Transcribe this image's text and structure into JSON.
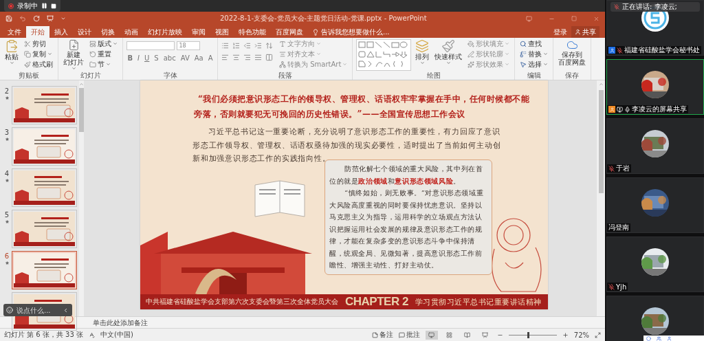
{
  "recorder": {
    "label": "录制中"
  },
  "title": "2022-8-1-支委会-党员大会-主题党日活动-党课.pptx - PowerPoint",
  "tabs": [
    {
      "label": "文件",
      "selected": false
    },
    {
      "label": "开始",
      "selected": true
    },
    {
      "label": "插入",
      "selected": false
    },
    {
      "label": "设计",
      "selected": false
    },
    {
      "label": "切换",
      "selected": false
    },
    {
      "label": "动画",
      "selected": false
    },
    {
      "label": "幻灯片放映",
      "selected": false
    },
    {
      "label": "审阅",
      "selected": false
    },
    {
      "label": "视图",
      "selected": false
    },
    {
      "label": "特色功能",
      "selected": false
    },
    {
      "label": "百度网盘",
      "selected": false
    }
  ],
  "tell_me": "告诉我您想要做什么...",
  "sign_in": "登录",
  "share": "共享",
  "ribbon": [
    {
      "kind": "clipboard",
      "label": "剪贴板",
      "big": [
        {
          "lines": [
            "粘贴"
          ],
          "dropdown": true
        }
      ],
      "small": [
        {
          "label": "剪切",
          "dropdown": false
        },
        {
          "label": "复制",
          "dropdown": true
        },
        {
          "label": "格式刷",
          "dropdown": false
        }
      ]
    },
    {
      "kind": "slides",
      "label": "幻灯片",
      "big": [
        {
          "lines": [
            "新建",
            "幻灯片"
          ],
          "dropdown": true
        }
      ],
      "small": [
        {
          "label": "版式",
          "dropdown": true
        },
        {
          "label": "重置",
          "dropdown": false
        },
        {
          "label": "节",
          "dropdown": true
        }
      ]
    },
    {
      "kind": "font",
      "label": "字体",
      "font_size": "18",
      "buttons": [
        "B",
        "I",
        "U",
        "S",
        "abc",
        "AV",
        "Aa",
        "A"
      ]
    },
    {
      "kind": "paragraph",
      "label": "段落",
      "small": [
        {
          "label": "文字方向",
          "dropdown": true
        },
        {
          "label": "对齐文本",
          "dropdown": true
        },
        {
          "label": "转换为 SmartArt",
          "dropdown": true
        }
      ]
    },
    {
      "kind": "drawing",
      "label": "绘图",
      "big": [
        {
          "lines": [
            "排列"
          ],
          "dropdown": true
        },
        {
          "lines": [
            "快速样式"
          ],
          "dropdown": true
        }
      ],
      "small": [
        {
          "label": "形状填充",
          "dropdown": true
        },
        {
          "label": "形状轮廓",
          "dropdown": true
        },
        {
          "label": "形状效果",
          "dropdown": true
        }
      ]
    },
    {
      "kind": "editing",
      "label": "编辑",
      "small": [
        {
          "label": "查找",
          "dropdown": false
        },
        {
          "label": "替换",
          "dropdown": true
        },
        {
          "label": "选择",
          "dropdown": true
        }
      ]
    },
    {
      "kind": "save",
      "label": "保存",
      "big": [
        {
          "lines": [
            "保存到",
            "百度网盘"
          ],
          "dropdown": false
        }
      ]
    }
  ],
  "thumbnails": [
    {
      "number": "2",
      "selected": false
    },
    {
      "number": "3",
      "selected": false
    },
    {
      "number": "4",
      "selected": false
    },
    {
      "number": "5",
      "selected": false
    },
    {
      "number": "6",
      "selected": true
    },
    {
      "selected": false
    }
  ],
  "chat": {
    "placeholder": "说点什么..."
  },
  "slide": {
    "quote": "“我们必须把意识形态工作的领导权、管理权、话语权牢牢掌握在手中，任何时候都不能旁落，否则就要犯无可挽回的历史性错误。”——全国宣传思想工作会议",
    "paragraph": "习近平总书记这一重要论断，充分说明了意识形态工作的重要性，有力回应了意识形态工作领导权、管理权、话语权亟待加强的现实必要性，适时提出了当前如何主动创新和加强意识形态工作的实践指向性。",
    "box": [
      "防范化解七个领域的重大风险，其中列在首位的就是**政治领域**和**意识形态领域风险**。",
      "“慎终如始，则无败事。”对意识形态领域重大风险高度重视的同时要保持忧患意识。坚持以马克思主义为指导，运用科学的立场观点方法认识把握运用社会发展的规律及意识形态工作的规律，才能在复杂多变的意识形态斗争中保持清醒，统观全局、见微知著，提高意识形态工作前瞻性、增强主动性、打好主动仗。"
    ],
    "footer_org": "中共福建省硅酸盐学会支部第六次支委会暨第三次全体党员大会",
    "chapter": "CHAPTER 2",
    "chapter_title": "学习贯彻习近平总书记重要讲话精神"
  },
  "notes": {
    "placeholder": "单击此处添加备注"
  },
  "status": {
    "slide_info": "幻灯片 第 6 张，共 33 张",
    "language": "中文(中国)",
    "notes": "备注",
    "comments": "批注",
    "views": [
      {
        "selected": true
      },
      {
        "selected": false
      },
      {
        "selected": false
      },
      {
        "selected": false
      }
    ],
    "zoom": {
      "level": 0.4,
      "reading": "72%"
    }
  },
  "meeting": {
    "speaking": "正在讲话: 李凌云;",
    "participants": [
      {
        "name": "福建省硅酸盐学会秘书处",
        "color": "#1f6fe5",
        "muted": true,
        "avatar": {
          "kind": "logo"
        },
        "selected": false
      },
      {
        "name": "李凌云的屏幕共享",
        "color": "#f08a24",
        "sharing": true,
        "muted": false,
        "selected": true
      },
      {
        "name": "于岩",
        "muted": true,
        "selected": false
      },
      {
        "name": "冯登南",
        "selected": false
      },
      {
        "name": "Yjh",
        "muted": true,
        "selected": false
      },
      {
        "selected": false
      }
    ]
  }
}
